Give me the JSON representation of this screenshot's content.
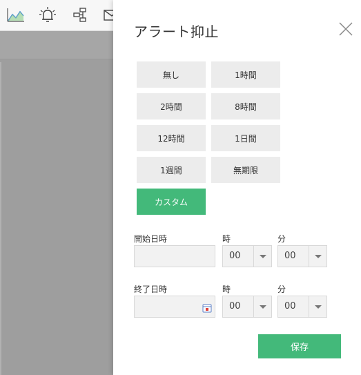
{
  "toolbar": {
    "icons": [
      "chart-icon",
      "alarm-bell-icon",
      "hierarchy-icon",
      "mail-icon"
    ]
  },
  "dialog": {
    "title": "アラート抑止",
    "close_icon": "close-icon",
    "presets": [
      {
        "label": "無し"
      },
      {
        "label": "1時間"
      },
      {
        "label": "2時間"
      },
      {
        "label": "8時間"
      },
      {
        "label": "12時間"
      },
      {
        "label": "1日間"
      },
      {
        "label": "1週間"
      },
      {
        "label": "無期限"
      },
      {
        "label": "カスタム",
        "selected": true
      }
    ],
    "start": {
      "label": "開始日時",
      "value": "",
      "hour_label": "時",
      "hour_value": "00",
      "minute_label": "分",
      "minute_value": "00"
    },
    "end": {
      "label": "終了日時",
      "value": "",
      "hour_label": "時",
      "hour_value": "00",
      "minute_label": "分",
      "minute_value": "00"
    },
    "save_label": "保存"
  },
  "colors": {
    "accent": "#43b97a",
    "preset_bg": "#ececec",
    "overlay": "#9e9e9e"
  }
}
